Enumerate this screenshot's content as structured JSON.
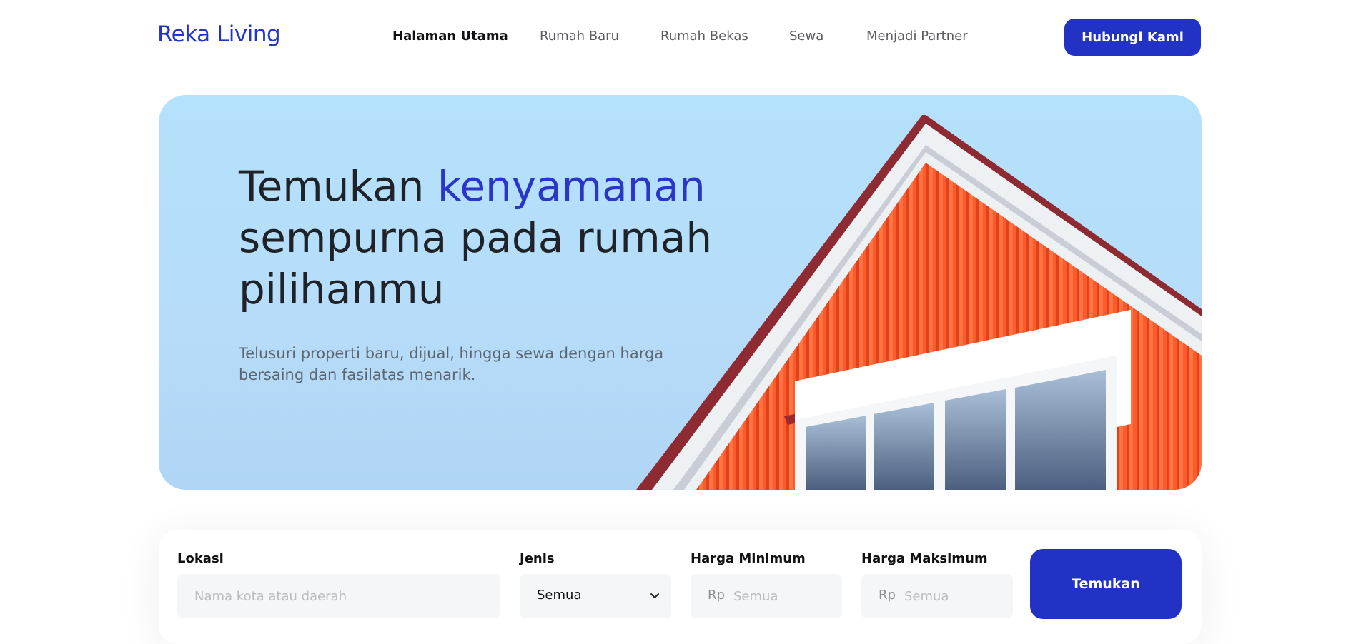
{
  "header": {
    "logo": "Reka Living",
    "nav": [
      {
        "label": "Halaman Utama",
        "active": true
      },
      {
        "label": "Rumah Baru",
        "active": false
      },
      {
        "label": "Rumah Bekas",
        "active": false
      },
      {
        "label": "Sewa",
        "active": false
      },
      {
        "label": "Menjadi Partner",
        "active": false
      }
    ],
    "contact_label": "Hubungi Kami"
  },
  "hero": {
    "title_prefix": "Temukan ",
    "title_accent": "kenyamanan",
    "title_line2": "sempurna pada rumah",
    "title_line3": "pilihanmu",
    "subtitle": "Telusuri properti baru, dijual, hingga sewa dengan harga bersaing dan fasilatas menarik."
  },
  "search": {
    "location": {
      "label": "Lokasi",
      "placeholder": "Nama kota atau daerah"
    },
    "type": {
      "label": "Jenis",
      "value": "Semua"
    },
    "min_price": {
      "label": "Harga Minimum",
      "prefix": "Rp",
      "placeholder": "Semua"
    },
    "max_price": {
      "label": "Harga Maksimum",
      "prefix": "Rp",
      "placeholder": "Semua"
    },
    "submit_label": "Temukan"
  },
  "colors": {
    "brand": "#2132c4",
    "hero_bg": "#b4e1fb",
    "house_orange": "#ff5a2b"
  }
}
